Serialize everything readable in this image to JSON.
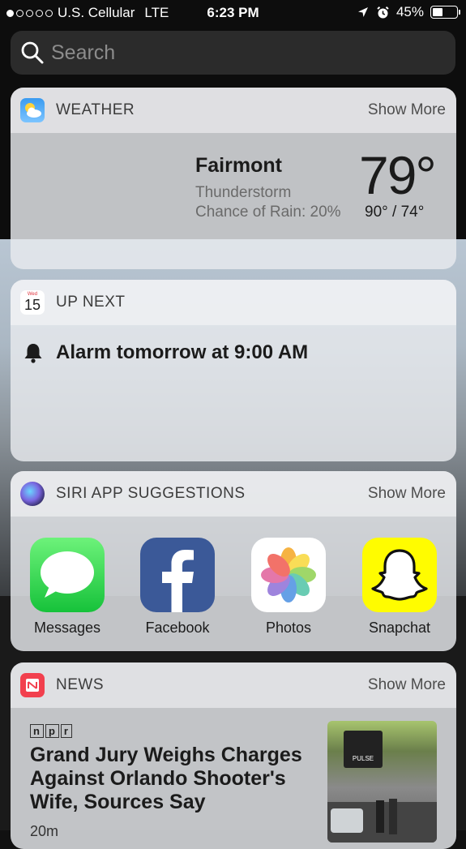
{
  "status_bar": {
    "signal_dots": 1,
    "carrier": "U.S. Cellular",
    "network": "LTE",
    "time": "6:23 PM",
    "battery": "45%",
    "battery_level": 0.45
  },
  "search": {
    "placeholder": "Search"
  },
  "weather": {
    "title": "WEATHER",
    "show_more": "Show More",
    "city": "Fairmont",
    "condition": "Thunderstorm",
    "rain": "Chance of Rain: 20%",
    "temp": "79°",
    "hi_lo": "90° / 74°"
  },
  "up_next": {
    "title": "UP NEXT",
    "calendar_weekday": "Wed",
    "calendar_day": "15",
    "alarm_text": "Alarm tomorrow at 9:00 AM"
  },
  "siri": {
    "title": "SIRI APP SUGGESTIONS",
    "show_more": "Show More",
    "apps": [
      {
        "label": "Messages"
      },
      {
        "label": "Facebook"
      },
      {
        "label": "Photos"
      },
      {
        "label": "Snapchat"
      }
    ]
  },
  "news": {
    "title": "NEWS",
    "show_more": "Show More",
    "source": [
      "n",
      "p",
      "r"
    ],
    "headline": "Grand Jury Weighs Charges Against Orlando Shooter's Wife, Sources Say",
    "age": "20m",
    "thumb_sign": "PULSE"
  },
  "colors": {
    "accent_news": "#f2404e",
    "facebook": "#3b5998",
    "snapchat": "#fffc00"
  }
}
